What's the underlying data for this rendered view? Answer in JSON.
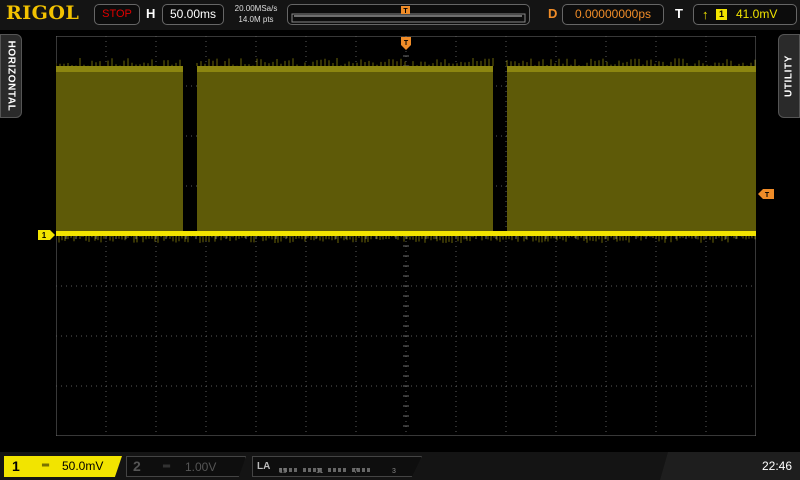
{
  "brand": "RIGOL",
  "topbar": {
    "run_state": "STOP",
    "h_label": "H",
    "timebase": "50.00ms",
    "sample_rate": "20.00MSa/s",
    "memory_depth": "14.0M pts",
    "memory_trigger_marker": "T",
    "d_label": "D",
    "delay": "0.00000000ps",
    "t_label": "T",
    "trigger_edge_icon": "rising-edge-icon",
    "trigger_source": "1",
    "trigger_level": "41.0mV"
  },
  "side_tabs": {
    "left": "HORIZONTAL",
    "right": "UTILITY"
  },
  "screen": {
    "trigger_position_marker": "T",
    "trigger_level_marker": "T",
    "channel1_marker": "1",
    "trace_color": "#f2e400"
  },
  "bottombar": {
    "ch1": {
      "number": "1",
      "coupling_icon": "dc-coupling-icon",
      "coupling_glyph": "═",
      "scale": "50.0mV"
    },
    "ch2": {
      "number": "2",
      "coupling_icon": "dc-coupling-icon",
      "coupling_glyph": "═",
      "scale": "1.00V"
    },
    "la": {
      "title": "LA",
      "group_labels": [
        "15",
        "11",
        "7",
        "3"
      ]
    },
    "clock": "22:46"
  }
}
